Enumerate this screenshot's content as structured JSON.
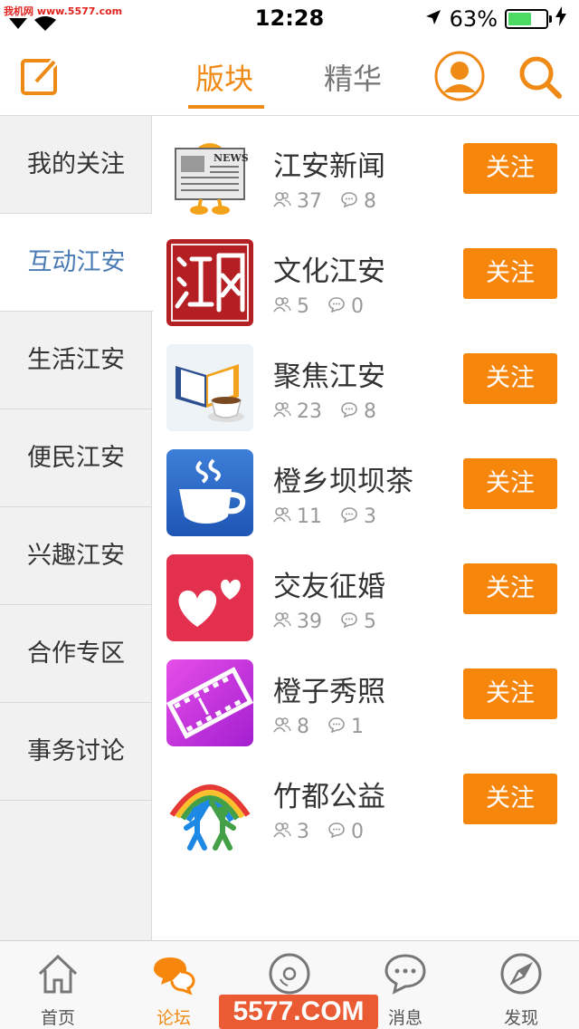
{
  "status_bar": {
    "watermark": "我机网 www.5577.com",
    "time": "12:28",
    "battery_percent": "63%",
    "battery_level": 0.63
  },
  "header": {
    "tabs": [
      {
        "label": "版块",
        "active": true
      },
      {
        "label": "精华",
        "active": false
      }
    ],
    "accent_color": "#f08a16"
  },
  "sidebar": {
    "items": [
      {
        "label": "我的关注",
        "active": false
      },
      {
        "label": "互动江安",
        "active": true
      },
      {
        "label": "生活江安",
        "active": false
      },
      {
        "label": "便民江安",
        "active": false
      },
      {
        "label": "兴趣江安",
        "active": false
      },
      {
        "label": "合作专区",
        "active": false
      },
      {
        "label": "事务讨论",
        "active": false
      }
    ]
  },
  "forums": [
    {
      "title": "江安新闻",
      "members": "37",
      "posts": "8",
      "follow_label": "关注",
      "icon": "newspaper-icon"
    },
    {
      "title": "文化江安",
      "members": "5",
      "posts": "0",
      "follow_label": "关注",
      "icon": "seal-icon"
    },
    {
      "title": "聚焦江安",
      "members": "23",
      "posts": "8",
      "follow_label": "关注",
      "icon": "book-coffee-icon"
    },
    {
      "title": "橙乡坝坝茶",
      "members": "11",
      "posts": "3",
      "follow_label": "关注",
      "icon": "tea-cup-icon"
    },
    {
      "title": "交友征婚",
      "members": "39",
      "posts": "5",
      "follow_label": "关注",
      "icon": "hearts-icon"
    },
    {
      "title": "橙子秀照",
      "members": "8",
      "posts": "1",
      "follow_label": "关注",
      "icon": "film-icon"
    },
    {
      "title": "竹都公益",
      "members": "3",
      "posts": "0",
      "follow_label": "关注",
      "icon": "charity-icon"
    }
  ],
  "tabbar": {
    "items": [
      {
        "label": "首页",
        "icon": "home-icon",
        "active": false
      },
      {
        "label": "论坛",
        "icon": "chat-bubbles-icon",
        "active": true
      },
      {
        "label": "",
        "icon": "disc-icon",
        "active": false
      },
      {
        "label": "消息",
        "icon": "message-icon",
        "active": false
      },
      {
        "label": "发现",
        "icon": "compass-icon",
        "active": false
      }
    ]
  },
  "overlay_watermark": "5577.COM"
}
